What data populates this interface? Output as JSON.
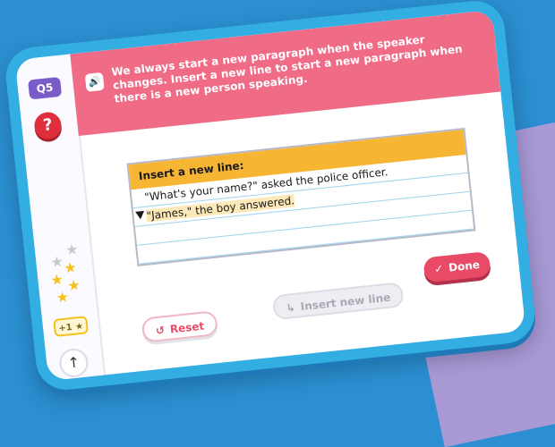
{
  "sidebar": {
    "question_badge": "Q5",
    "help_label": "?",
    "bonus_label": "+1 ★",
    "up_label": "↑"
  },
  "banner": {
    "speaker_icon": "🔊",
    "instruction": "We always start a new paragraph when the speaker changes. Insert a new line to start a new paragraph when there is a new person speaking."
  },
  "task": {
    "heading": "Insert a new line:",
    "line1": "\"What's your name?\" asked the police officer.",
    "line2": "\"James,\" the boy answered."
  },
  "buttons": {
    "done": "Done",
    "insert_new_line": "Insert new line",
    "reset": "Reset"
  },
  "colors": {
    "banner": "#f06b86",
    "task_header": "#f7b534",
    "done": "#e94b66",
    "badge": "#7a5cc9"
  }
}
